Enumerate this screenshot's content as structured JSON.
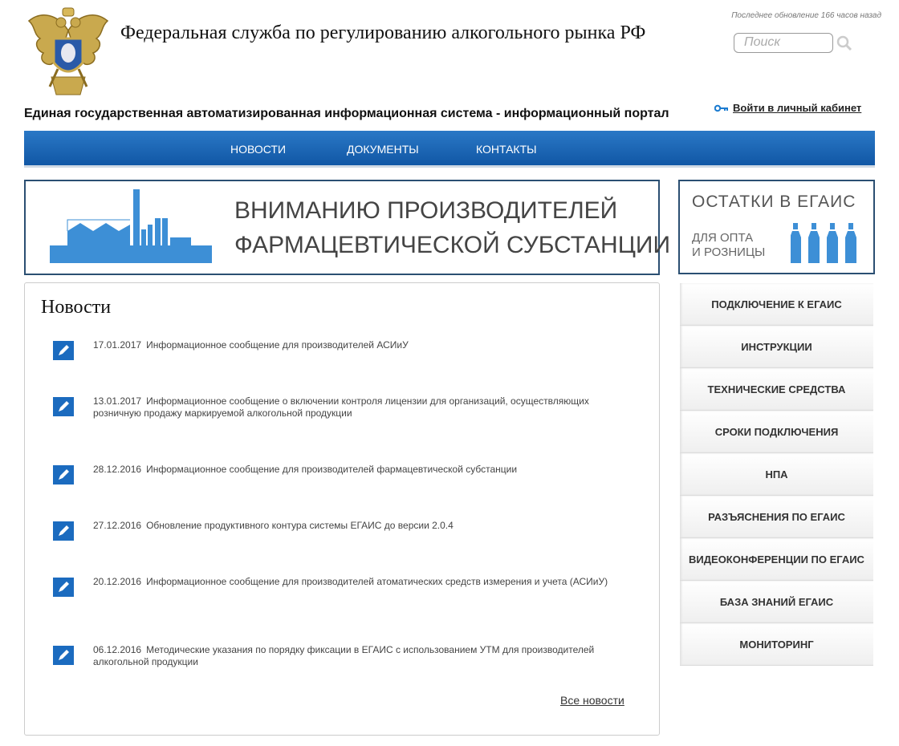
{
  "header": {
    "site_title": "Федеральная служба по регулированию алкогольного рынка РФ",
    "last_update": "Последнее обновление 166 часов назад",
    "search_placeholder": "Поиск",
    "portal_title": "Единая государственная автоматизированная информационная система - информационный портал",
    "login_label": "Войти в личный кабинет"
  },
  "nav": {
    "items": [
      {
        "label": "НОВОСТИ"
      },
      {
        "label": "ДОКУМЕНТЫ"
      },
      {
        "label": "КОНТАКТЫ"
      }
    ]
  },
  "banner": {
    "line1": "ВНИМАНИЮ ПРОИЗВОДИТЕЛЕЙ",
    "line2": "ФАРМАЦЕВТИЧЕСКОЙ СУБСТАНЦИИ"
  },
  "stock": {
    "title": "ОСТАТКИ В ЕГАИС",
    "line1": "ДЛЯ ОПТА",
    "line2": "И РОЗНИЦЫ"
  },
  "news": {
    "title": "Новости",
    "items": [
      {
        "date": "17.01.2017",
        "text": "Информационное сообщение для производителей АСИиУ"
      },
      {
        "date": "13.01.2017",
        "text": "Информационное сообщение о включении контроля лицензии для организаций, осуществляющих розничную продажу маркируемой алкогольной продукции"
      },
      {
        "date": "28.12.2016",
        "text": "Информационное сообщение для производителей фармацевтической субстанции"
      },
      {
        "date": "27.12.2016",
        "text": "Обновление продуктивного контура системы ЕГАИС до версии 2.0.4"
      },
      {
        "date": "20.12.2016",
        "text": "Информационное сообщение для производителей атоматических средств измерения и учета (АСИиУ)"
      },
      {
        "date": "06.12.2016",
        "text": "Методические указания по порядку фиксации в ЕГАИС с использованием УТМ для производителей алкогольной продукции"
      }
    ],
    "all_label": "Все новости"
  },
  "side_menu": {
    "items": [
      {
        "label": "ПОДКЛЮЧЕНИЕ К ЕГАИС"
      },
      {
        "label": "ИНСТРУКЦИИ"
      },
      {
        "label": "ТЕХНИЧЕСКИЕ СРЕДСТВА"
      },
      {
        "label": "СРОКИ ПОДКЛЮЧЕНИЯ"
      },
      {
        "label": "НПА"
      },
      {
        "label": "РАЗЪЯСНЕНИЯ ПО ЕГАИС"
      },
      {
        "label": "ВИДЕОКОНФЕРЕНЦИИ ПО ЕГАИС"
      },
      {
        "label": "БАЗА ЗНАНИЙ ЕГАИС"
      },
      {
        "label": "МОНИТОРИНГ"
      }
    ]
  },
  "colors": {
    "nav_blue": "#1b65b4",
    "border_navy": "#2b4f72",
    "icon_blue": "#1b6bbf",
    "banner_blue": "#3d8fd6"
  }
}
